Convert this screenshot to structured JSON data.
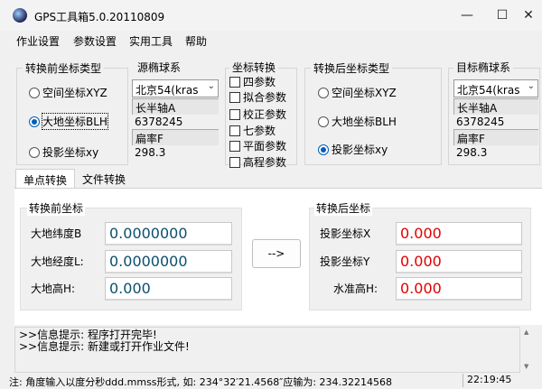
{
  "window": {
    "title": "GPS工具箱5.0.20110809",
    "minimize": "—",
    "maximize": "☐",
    "close": "✕"
  },
  "menu": [
    "作业设置",
    "参数设置",
    "实用工具",
    "帮助"
  ],
  "src_coord": {
    "label": "转换前坐标类型",
    "options": [
      "空间坐标XYZ",
      "大地坐标BLH",
      "投影坐标xy"
    ],
    "selected": "大地坐标BLH"
  },
  "src_ellipsoid": {
    "label": "源椭球系",
    "selected": "北京54(kras",
    "a_label": "长半轴A",
    "a_value": "6378245",
    "f_label": "扁率F",
    "f_value": "298.3"
  },
  "transform": {
    "label": "坐标转换",
    "options": [
      "四参数",
      "拟合参数",
      "校正参数",
      "七参数",
      "平面参数",
      "高程参数"
    ]
  },
  "dst_coord": {
    "label": "转换后坐标类型",
    "options": [
      "空间坐标XYZ",
      "大地坐标BLH",
      "投影坐标xy"
    ],
    "selected": "投影坐标xy"
  },
  "dst_ellipsoid": {
    "label": "目标椭球系",
    "selected": "北京54(kras",
    "a_label": "长半轴A",
    "a_value": "6378245",
    "f_label": "扁率F",
    "f_value": "298.3"
  },
  "tabs": [
    "单点转换",
    "文件转换"
  ],
  "before": {
    "label": "转换前坐标",
    "lat_label": "大地纬度B",
    "lat": "0.0000000",
    "lon_label": "大地经度L:",
    "lon": "0.0000000",
    "h_label": "大地高H:",
    "h": "0.000"
  },
  "convert_button": "-->",
  "after": {
    "label": "转换后坐标",
    "x_label": "投影坐标X",
    "x": "0.000",
    "y_label": "投影坐标Y",
    "y": "0.000",
    "h_label": "水准高H:",
    "h": "0.000"
  },
  "log": [
    ">>信息提示: 程序打开完毕!",
    ">>信息提示: 新建或打开作业文件!"
  ],
  "status": {
    "note": "注: 角度输入以度分秒ddd.mmss形式, 如: 234°32′21.4568″应输为: 234.32214568",
    "time": "22:19:45"
  },
  "colors": {
    "accent": "#005fb8",
    "value_blue": "#0a4f6e",
    "value_red": "#e00000"
  }
}
